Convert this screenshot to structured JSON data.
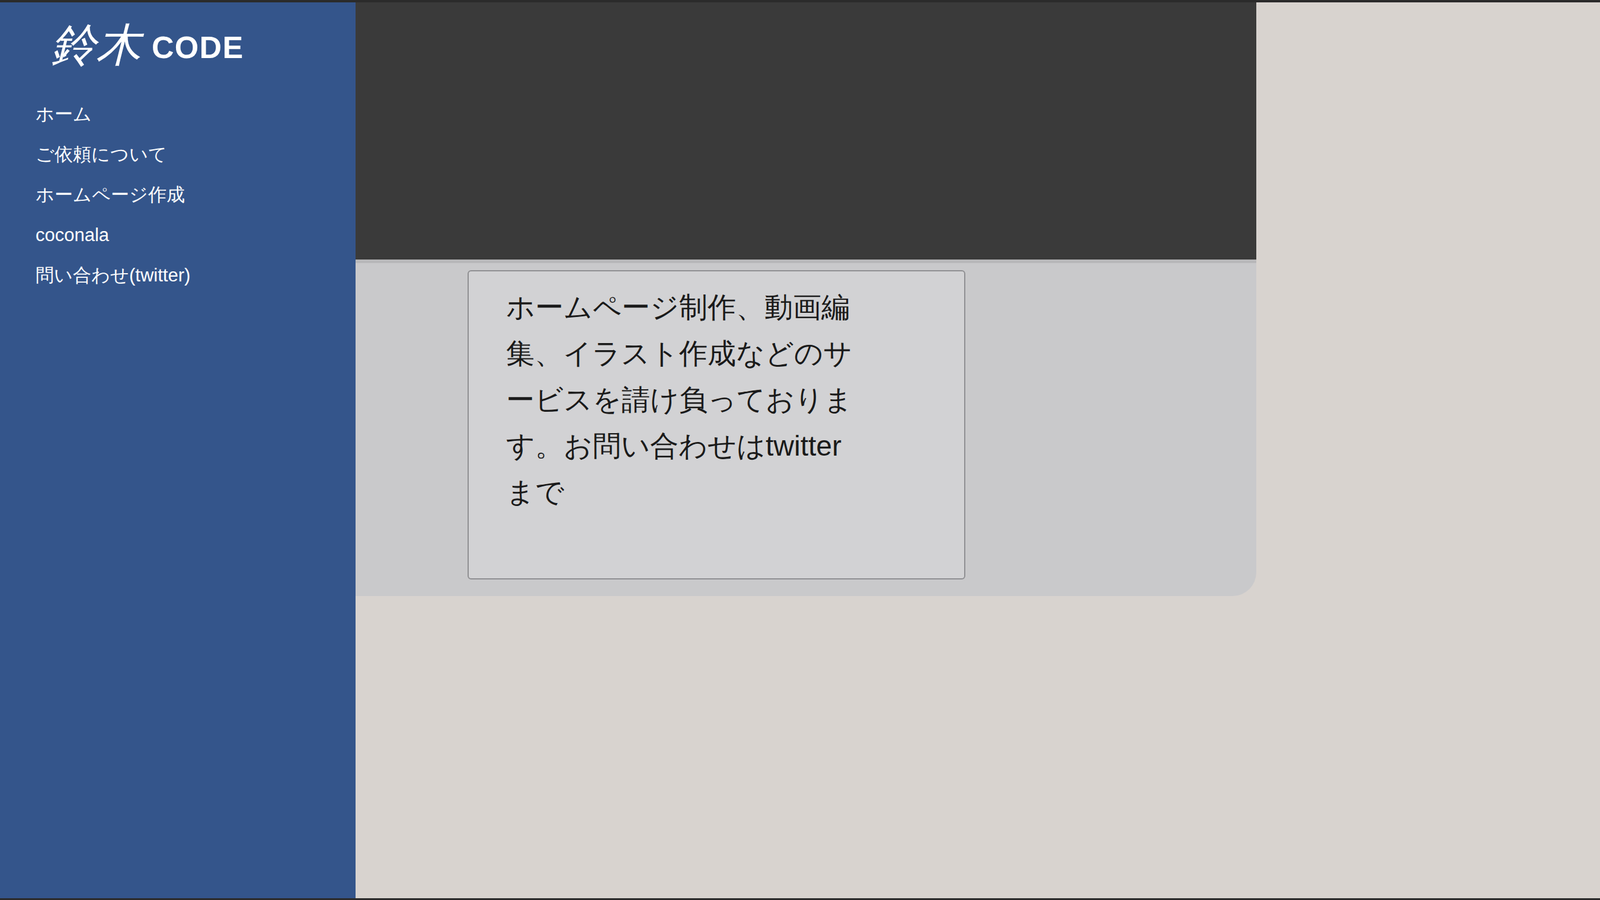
{
  "logo": {
    "kanji": "鈴木",
    "text": "CODE"
  },
  "sidebar": {
    "items": [
      "ホーム",
      "ご依頼について",
      "ホームページ作成",
      "coconala",
      "問い合わせ(twitter)"
    ]
  },
  "hero": {
    "text": "ホームページ制作、動画編集、イラスト作成などのサービスを請け負っております。お問い合わせはtwitterまで"
  }
}
